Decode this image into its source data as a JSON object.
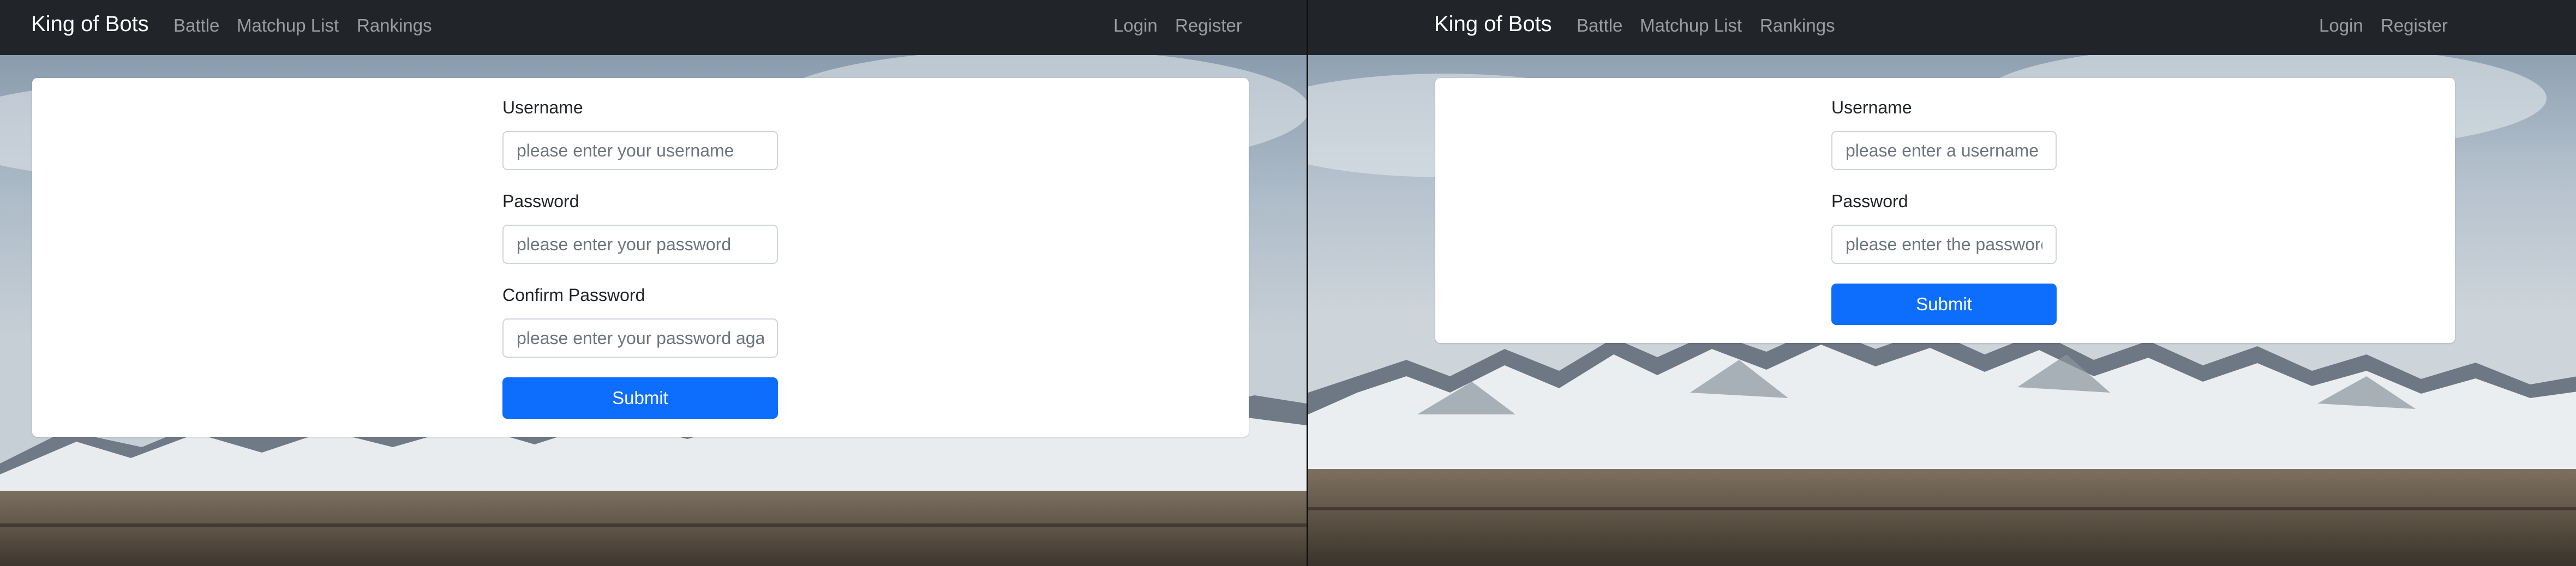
{
  "left_window": {
    "navbar": {
      "brand": "King of Bots",
      "links": [
        "Battle",
        "Matchup List",
        "Rankings"
      ],
      "login": "Login",
      "register": "Register"
    },
    "form": {
      "username_label": "Username",
      "username_placeholder": "please enter your username",
      "password_label": "Password",
      "password_placeholder": "please enter your password",
      "confirm_label": "Confirm Password",
      "confirm_placeholder": "please enter your password again",
      "submit_label": "Submit"
    }
  },
  "right_window": {
    "navbar": {
      "brand": "King of Bots",
      "links": [
        "Battle",
        "Matchup List",
        "Rankings"
      ],
      "login": "Login",
      "register": "Register"
    },
    "form": {
      "username_label": "Username",
      "username_placeholder": "please enter a username",
      "password_label": "Password",
      "password_placeholder": "please enter the password",
      "submit_label": "Submit"
    }
  },
  "colors": {
    "navbar_bg": "#212529",
    "primary": "#0d6efd",
    "card_bg": "#ffffff"
  }
}
